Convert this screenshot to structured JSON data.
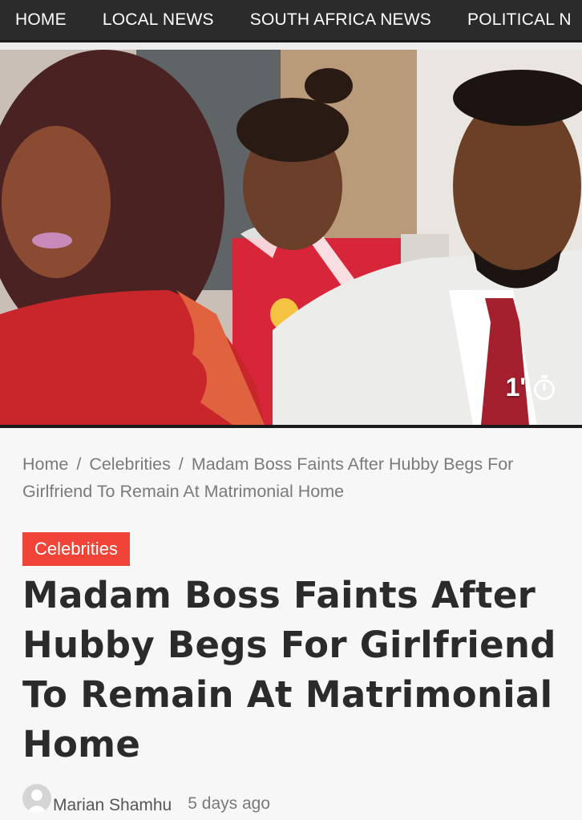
{
  "nav": {
    "items": [
      "HOME",
      "LOCAL NEWS",
      "SOUTH AFRICA NEWS",
      "POLITICAL N"
    ]
  },
  "hero": {
    "duration": "1'",
    "icons": [
      "stopwatch-icon"
    ]
  },
  "breadcrumb": {
    "home": "Home",
    "separator": "/",
    "category": "Celebrities",
    "current": "Madam Boss Faints After Hubby Begs For Girlfriend To Remain At Matrimonial Home"
  },
  "article": {
    "category": "Celebrities",
    "title": "Madam Boss Faints After Hubby Begs For Girlfriend To Remain At Matrimonial Home",
    "author": "Marian Shamhu",
    "date": "5 days ago"
  },
  "colors": {
    "nav_bg": "#2b2b2b",
    "category_bg": "#f04438",
    "title_text": "#2b2b2b",
    "muted_text": "#7a7a7a"
  }
}
